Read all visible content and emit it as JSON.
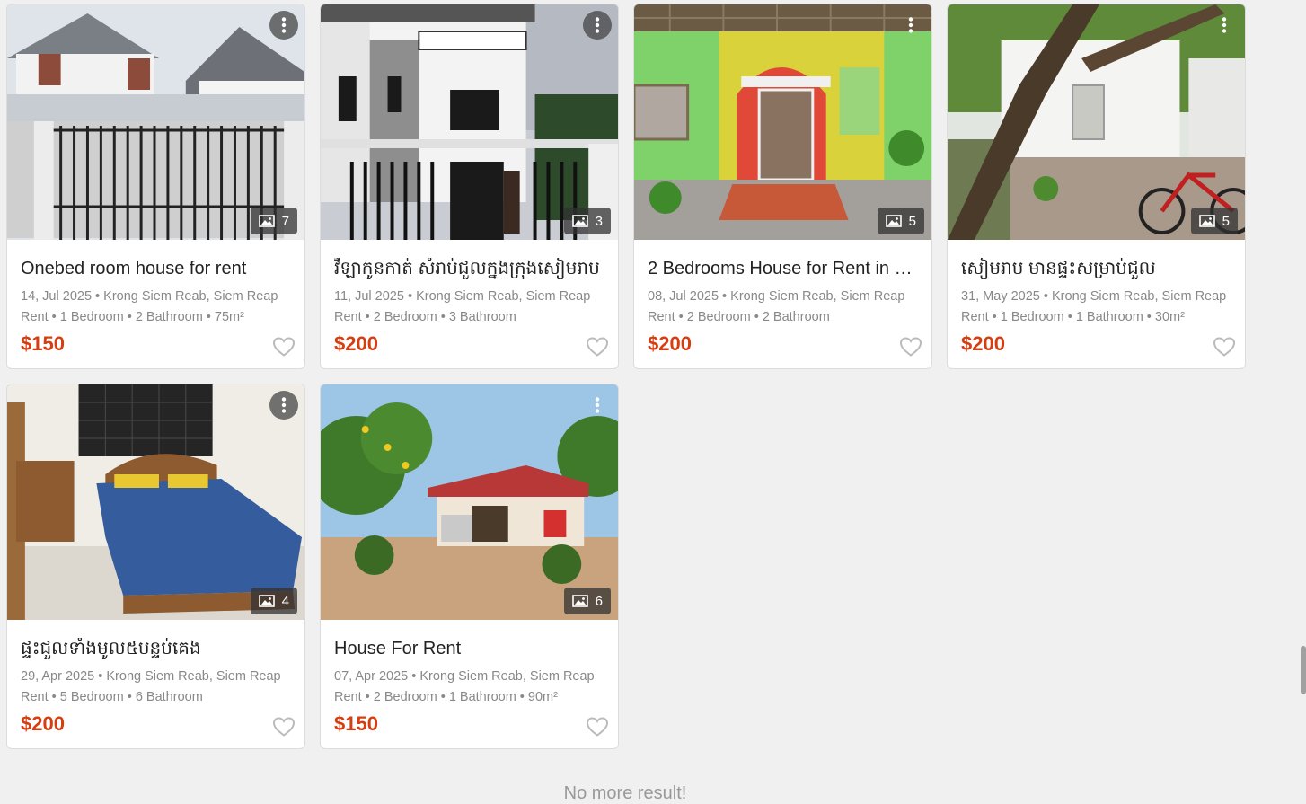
{
  "listings": [
    {
      "title": "Onebed room house for rent",
      "date": "14, Jul 2025",
      "location": "Krong Siem Reab, Siem Reap",
      "details": "Rent • 1 Bedroom • 2 Bathroom • 75m²",
      "price": "$150",
      "photo_count": "7"
    },
    {
      "title": "វីឡាកូនកាត់ សំរាប់ជួលក្នុងក្រុងសៀមរាប",
      "date": "11, Jul 2025",
      "location": "Krong Siem Reab, Siem Reap",
      "details": "Rent • 2 Bedroom • 3 Bathroom",
      "price": "$200",
      "photo_count": "3"
    },
    {
      "title": "2 Bedrooms House for Rent in Si...",
      "date": "08, Jul 2025",
      "location": "Krong Siem Reab, Siem Reap",
      "details": "Rent • 2 Bedroom • 2 Bathroom",
      "price": "$200",
      "photo_count": "5"
    },
    {
      "title": "សៀមរាប មានផ្ទះសម្រាប់ជួល",
      "date": "31, May 2025",
      "location": "Krong Siem Reab, Siem Reap",
      "details": "Rent • 1 Bedroom • 1 Bathroom • 30m²",
      "price": "$200",
      "photo_count": "5"
    },
    {
      "title": "ផ្ទះជួលទាំងមូល៥បន្ទប់គេង",
      "date": "29, Apr 2025",
      "location": "Krong Siem Reab, Siem Reap",
      "details": "Rent • 5 Bedroom • 6 Bathroom",
      "price": "$200",
      "photo_count": "4"
    },
    {
      "title": "House For Rent",
      "date": "07, Apr 2025",
      "location": "Krong Siem Reab, Siem Reap",
      "details": "Rent • 2 Bedroom • 1 Bathroom • 90m²",
      "price": "$150",
      "photo_count": "6"
    }
  ],
  "footer": {
    "no_more_text": "No more result!"
  },
  "icons": {
    "menu": "more-vertical-icon",
    "photos": "image-icon",
    "favorite": "heart-outline-icon"
  },
  "colors": {
    "price": "#d63d10",
    "background": "#f0f0f0"
  }
}
